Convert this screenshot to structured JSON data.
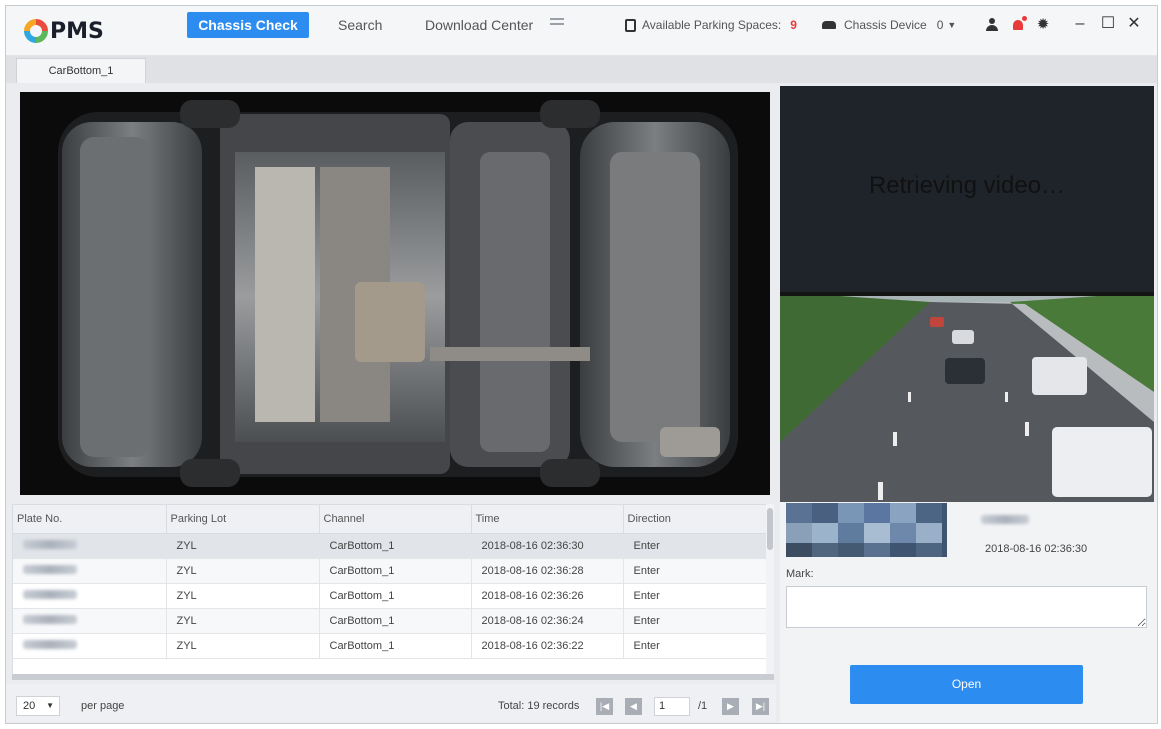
{
  "app": {
    "logo_text": "PMS"
  },
  "nav": {
    "active_label": "Chassis Check",
    "search_label": "Search",
    "download_label": "Download Center"
  },
  "status": {
    "parking_label": "Available Parking Spaces:",
    "parking_count": "9",
    "chassis_label": "Chassis Device",
    "chassis_count": "0"
  },
  "window": {
    "minimize": "–",
    "maximize": "☐",
    "close": "✕"
  },
  "tabs": [
    {
      "label": "CarBottom_1"
    }
  ],
  "video": {
    "retrieving_text": "Retrieving video…"
  },
  "table": {
    "columns": [
      "Plate No.",
      "Parking Lot",
      "Channel",
      "Time",
      "Direction"
    ],
    "rows": [
      {
        "lot": "ZYL",
        "channel": "CarBottom_1",
        "time": "2018-08-16 02:36:30",
        "direction": "Enter"
      },
      {
        "lot": "ZYL",
        "channel": "CarBottom_1",
        "time": "2018-08-16 02:36:28",
        "direction": "Enter"
      },
      {
        "lot": "ZYL",
        "channel": "CarBottom_1",
        "time": "2018-08-16 02:36:26",
        "direction": "Enter"
      },
      {
        "lot": "ZYL",
        "channel": "CarBottom_1",
        "time": "2018-08-16 02:36:24",
        "direction": "Enter"
      },
      {
        "lot": "ZYL",
        "channel": "CarBottom_1",
        "time": "2018-08-16 02:36:22",
        "direction": "Enter"
      }
    ]
  },
  "pager": {
    "page_size": "20",
    "per_page_label": "per page",
    "total_text": "Total:  19 records",
    "current_page": "1",
    "total_pages": "/1",
    "first_icon": "first-page-icon",
    "prev_icon": "prev-page-icon",
    "next_icon": "next-page-icon",
    "last_icon": "last-page-icon"
  },
  "detail": {
    "time": "2018-08-16 02:36:30",
    "mark_label": "Mark:",
    "open_label": "Open"
  },
  "colors": {
    "accent": "#2d8cf0",
    "alert": "#e83a3a"
  }
}
